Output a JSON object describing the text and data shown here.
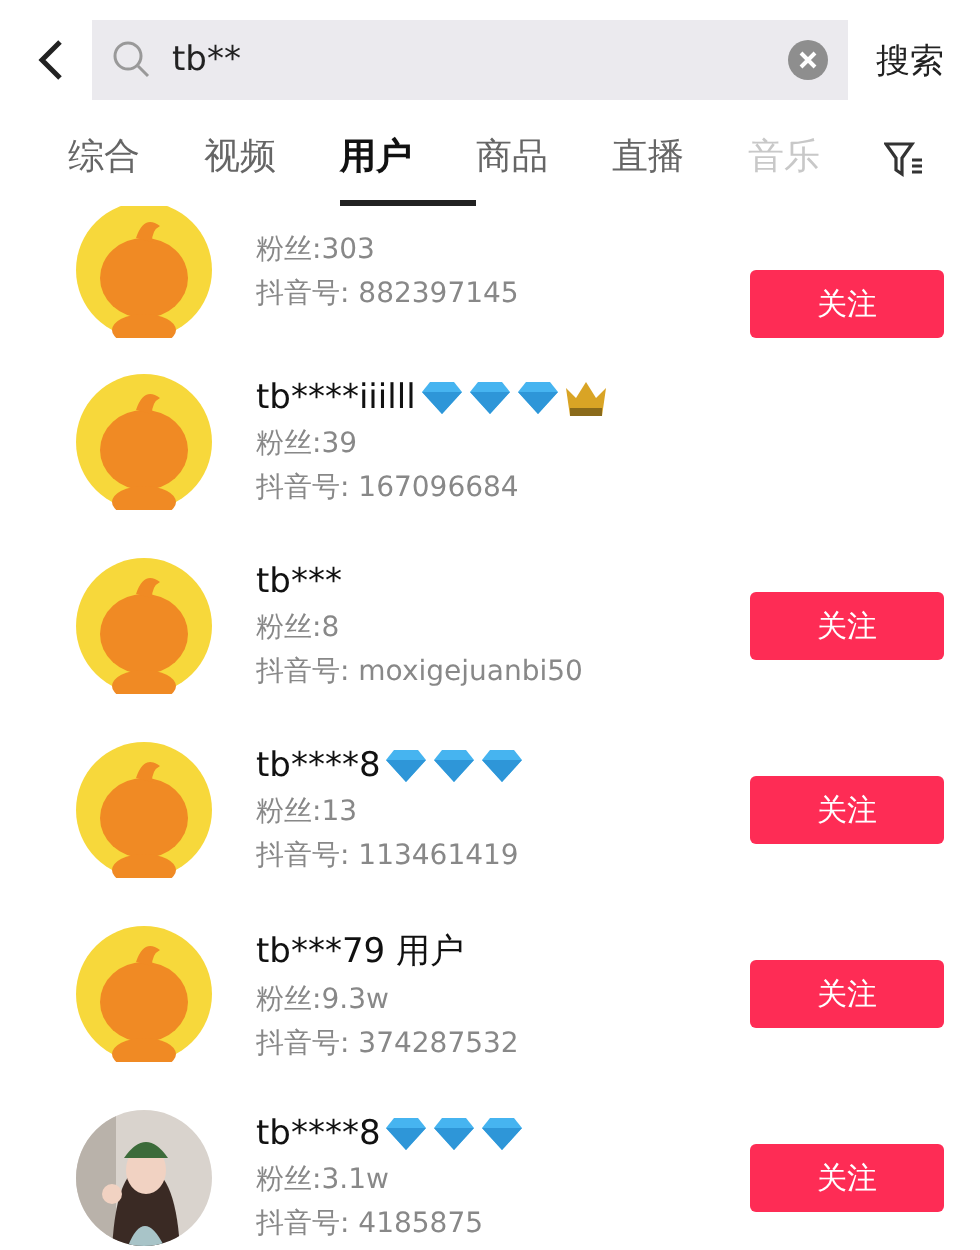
{
  "search": {
    "value": "tb**",
    "submit": "搜索"
  },
  "tabs": [
    {
      "label": "综合",
      "selected": false
    },
    {
      "label": "视频",
      "selected": false
    },
    {
      "label": "用户",
      "selected": true
    },
    {
      "label": "商品",
      "selected": false
    },
    {
      "label": "直播",
      "selected": false
    },
    {
      "label": "音乐",
      "selected": false,
      "faded": true
    }
  ],
  "users": [
    {
      "avatar": {
        "kind": "mascot"
      },
      "fans": "粉丝:303",
      "douyin_id": "抖音号: 882397145",
      "follow": "关注"
    },
    {
      "avatar": {
        "kind": "mascot"
      },
      "name": "tb****iiilll",
      "badges": [
        {
          "kind": "diamond"
        },
        {
          "kind": "diamond"
        },
        {
          "kind": "diamond"
        },
        {
          "kind": "crown"
        }
      ],
      "fans": "粉丝:39",
      "douyin_id": "抖音号: 167096684"
    },
    {
      "avatar": {
        "kind": "mascot"
      },
      "name": "tb***",
      "fans": "粉丝:8",
      "douyin_id": "抖音号: moxigejuanbi50",
      "follow": "关注"
    },
    {
      "avatar": {
        "kind": "mascot"
      },
      "name": "tb****8",
      "badges": [
        {
          "kind": "diamond"
        },
        {
          "kind": "diamond"
        },
        {
          "kind": "diamond"
        }
      ],
      "fans": "粉丝:13",
      "douyin_id": "抖音号: 113461419",
      "follow": "关注"
    },
    {
      "avatar": {
        "kind": "mascot"
      },
      "name": "tb***79 用户",
      "fans": "粉丝:9.3w",
      "douyin_id": "抖音号: 374287532",
      "follow": "关注"
    },
    {
      "avatar": {
        "kind": "picture"
      },
      "name": "tb****8",
      "badges": [
        {
          "kind": "diamond"
        },
        {
          "kind": "diamond"
        },
        {
          "kind": "diamond"
        }
      ],
      "fans": "粉丝:3.1w",
      "douyin_id": "抖音号: 4185875",
      "follow": "关注"
    }
  ]
}
